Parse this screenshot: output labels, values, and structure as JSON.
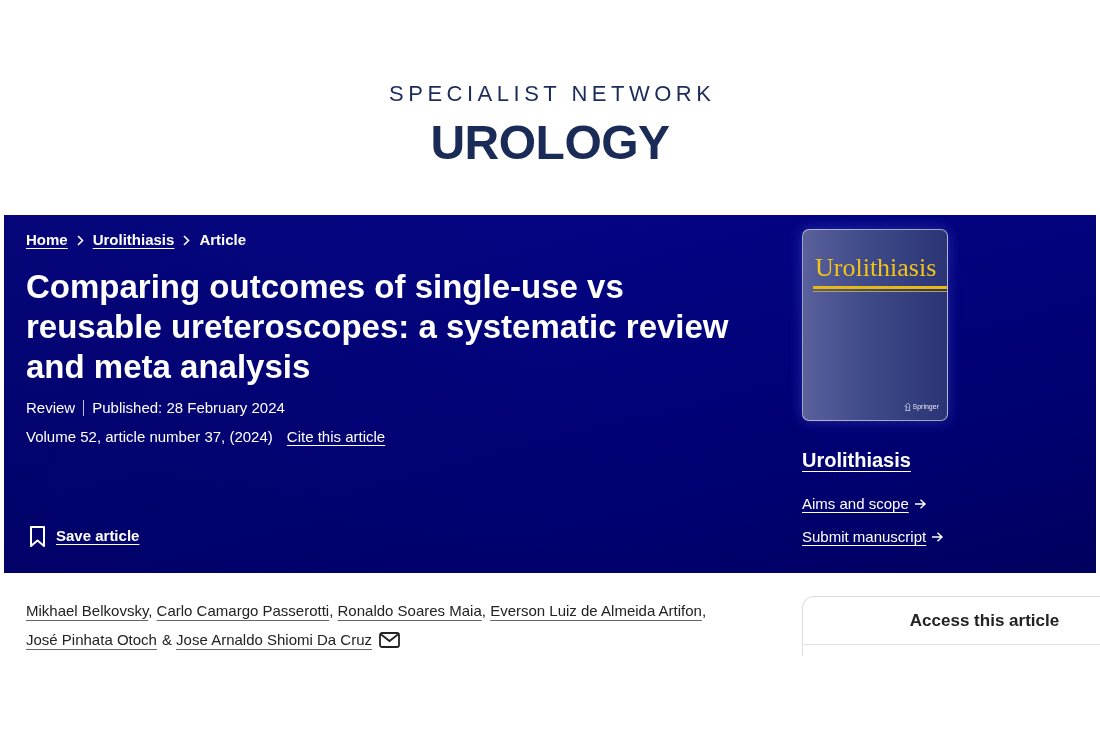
{
  "site_header": {
    "network": "SPECIALIST NETWORK",
    "specialty": "UROLOGY"
  },
  "breadcrumb": [
    {
      "label": "Home",
      "kind": "link"
    },
    {
      "label": "Urolithiasis",
      "kind": "link"
    },
    {
      "label": "Article",
      "kind": "current"
    }
  ],
  "article": {
    "title": "Comparing outcomes of single-use vs reusable ureteroscopes: a systematic review and meta analysis",
    "meta": [
      "Review",
      "Published: 28 February 2024"
    ],
    "citation": "Volume 52, article number 37, (2024)",
    "cite_link": "Cite this article",
    "save_label": "Save article"
  },
  "journal": {
    "cover": {
      "title": "Urolithiasis",
      "publisher": "Springer"
    },
    "name": "Urolithiasis",
    "links": [
      "Aims and scope",
      "Submit manuscript"
    ]
  },
  "authors": [
    {
      "name": "Mikhael Belkovsky",
      "separator": {
        "text": ",",
        "kind": "trailing"
      },
      "corresponding": false
    },
    {
      "name": "Carlo Camargo Passerotti",
      "separator": {
        "text": ",",
        "kind": "trailing"
      },
      "corresponding": false
    },
    {
      "name": "Ronaldo Soares Maia",
      "separator": {
        "text": ",",
        "kind": "trailing"
      },
      "corresponding": false
    },
    {
      "name": "Everson Luiz de Almeida Artifon",
      "separator": {
        "text": ",",
        "kind": "trailing"
      },
      "corresponding": false
    },
    {
      "name": "José Pinhata Otoch",
      "separator": {
        "text": "&",
        "kind": "spaced"
      },
      "corresponding": false
    },
    {
      "name": "Jose Arnaldo Shiomi Da Cruz",
      "corresponding": true
    }
  ],
  "access_panel": {
    "title": "Access this article"
  }
}
